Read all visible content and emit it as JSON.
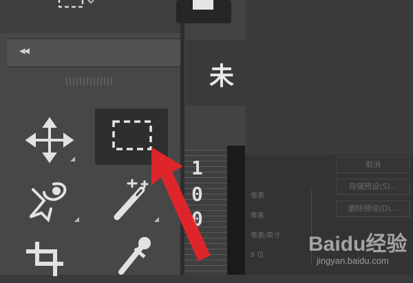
{
  "panel": {
    "collapse_label": "◂◂"
  },
  "document_tab": {
    "title": "未"
  },
  "ruler": {
    "digits": [
      "1",
      "0",
      "0"
    ]
  },
  "dialog": {
    "buttons": [
      "取消",
      "存储预设(S)...",
      "删除预设(D)..."
    ],
    "labels": [
      "像素",
      "像素",
      "像素/英寸",
      "8 位"
    ]
  },
  "watermark": {
    "brand": "Baidu经验",
    "url": "jingyan.baidu.com"
  },
  "icons": [
    "move-icon",
    "rect-marquee-icon",
    "lasso-icon",
    "magic-wand-icon",
    "crop-icon",
    "eyedropper-icon",
    "red-arrow-pointer"
  ],
  "colors": {
    "toolbar_bg": "#474747",
    "selected_tool_bg": "#2e2e2e",
    "arrow": "#e8242b"
  }
}
